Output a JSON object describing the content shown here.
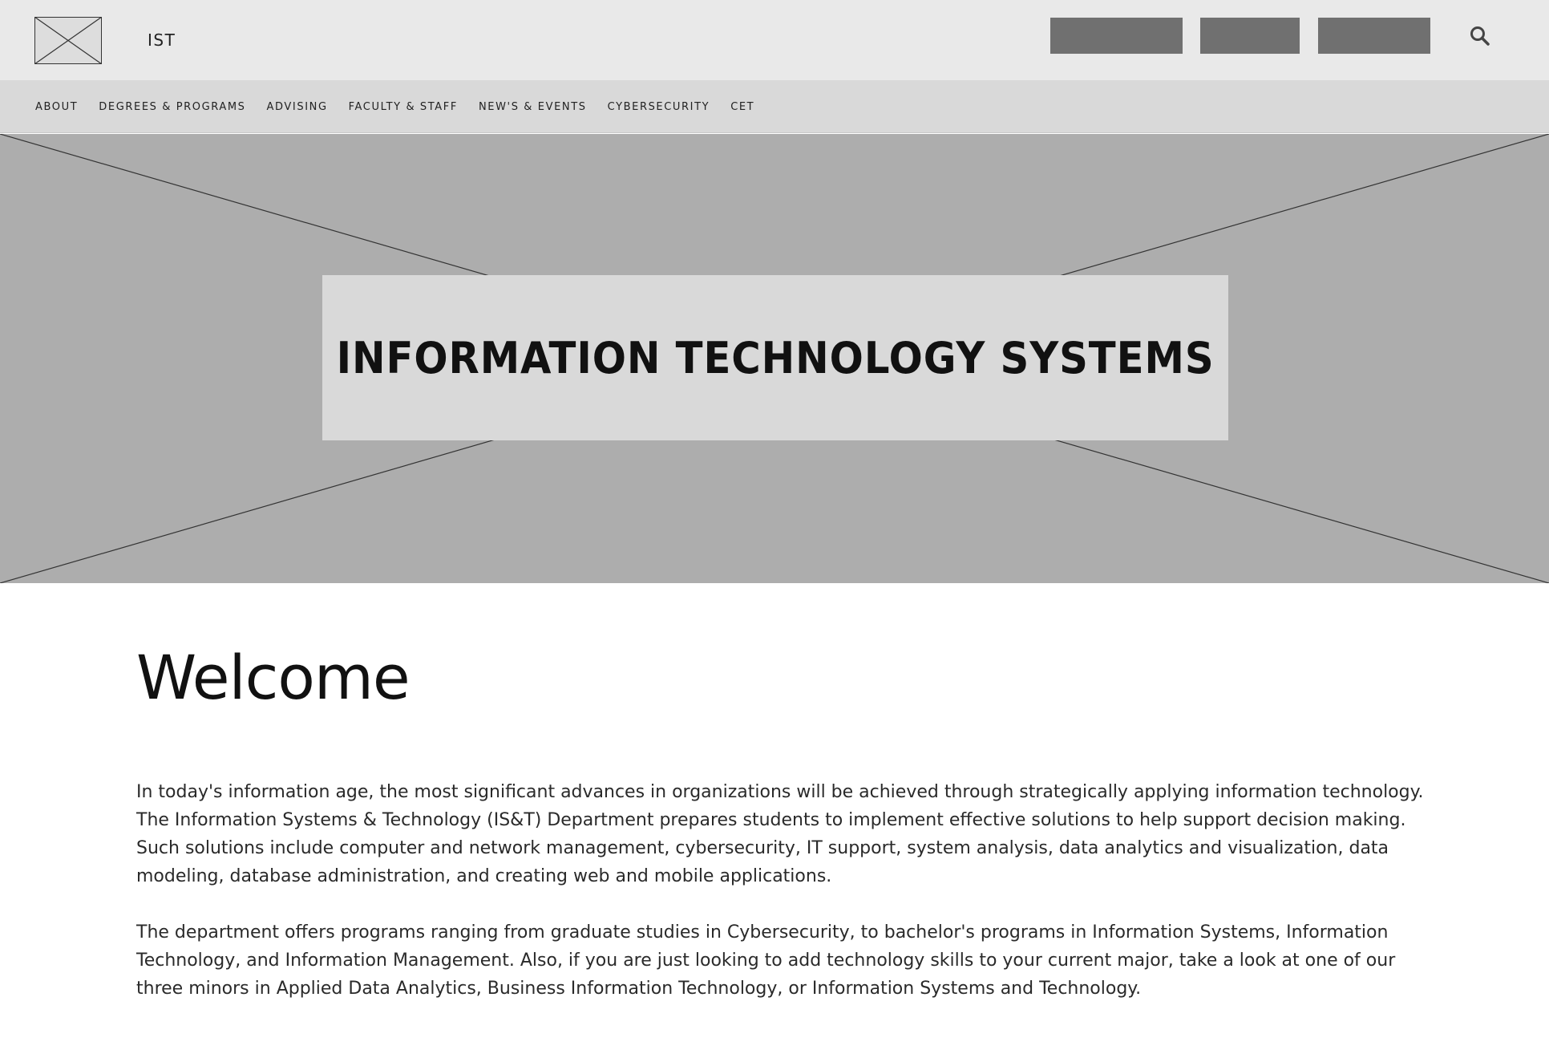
{
  "header": {
    "logo_icon": "placeholder-image-icon",
    "site_name": "IST",
    "utility_buttons": [
      "",
      "",
      ""
    ],
    "search_icon": "search-icon"
  },
  "nav": {
    "items": [
      {
        "label": "ABOUT"
      },
      {
        "label": "DEGREES & PROGRAMS"
      },
      {
        "label": "ADVISING"
      },
      {
        "label": "FACULTY & STAFF"
      },
      {
        "label": "NEW'S & EVENTS"
      },
      {
        "label": "CYBERSECURITY"
      },
      {
        "label": "CET"
      }
    ]
  },
  "hero": {
    "image_icon": "placeholder-image-icon",
    "title": "INFORMATION TECHNOLOGY SYSTEMS"
  },
  "main": {
    "heading": "Welcome",
    "paragraphs": [
      "In today's information age, the most significant advances in organizations will be achieved through strategically applying information technology. The Information Systems & Technology (IS&T) Department prepares students to implement effective solutions to help support decision making. Such solutions include computer and network management, cybersecurity, IT support, system analysis, data analytics and visualization, data modeling, database administration, and creating web and mobile applications.",
      "The department offers programs ranging from graduate studies in Cybersecurity, to bachelor's programs in Information Systems, Information Technology, and Information Management. Also, if you are just looking to add technology skills to your current major, take a look at one of our three minors in Applied Data Analytics, Business Information Technology, or Information Systems and Technology."
    ]
  },
  "colors": {
    "header_bg": "#e9e9e9",
    "nav_bg": "#d9d9d9",
    "hero_bg": "#adadad",
    "button_bg": "#707070"
  }
}
